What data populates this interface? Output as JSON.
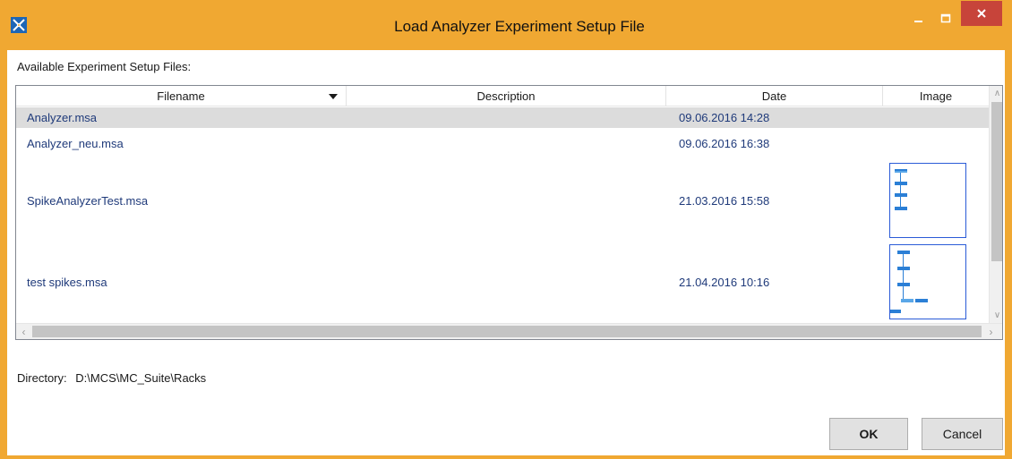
{
  "window": {
    "title": "Load Analyzer Experiment Setup File",
    "accent_color": "#f0a832",
    "close_color": "#c7443a",
    "controls": {
      "minimize_icon": "minimize-icon",
      "maximize_icon": "maximize-icon",
      "close_icon": "close-icon"
    }
  },
  "dialog": {
    "available_label": "Available Experiment Setup Files:",
    "columns": {
      "filename": "Filename",
      "description": "Description",
      "date": "Date",
      "image": "Image"
    },
    "sort_icon": "sort-descending-icon",
    "rows": [
      {
        "filename": "Analyzer.msa",
        "description": "",
        "date": "09.06.2016 14:28",
        "has_image": false,
        "selected": true
      },
      {
        "filename": "Analyzer_neu.msa",
        "description": "",
        "date": "09.06.2016 16:38",
        "has_image": false,
        "selected": false
      },
      {
        "filename": "SpikeAnalyzerTest.msa",
        "description": "",
        "date": "21.03.2016 15:58",
        "has_image": true,
        "selected": false
      },
      {
        "filename": "test spikes.msa",
        "description": "",
        "date": "21.04.2016 10:16",
        "has_image": true,
        "selected": false
      }
    ],
    "directory_label": "Directory:",
    "directory_value": "D:\\MCS\\MC_Suite\\Racks",
    "ok_label": "OK",
    "cancel_label": "Cancel"
  }
}
